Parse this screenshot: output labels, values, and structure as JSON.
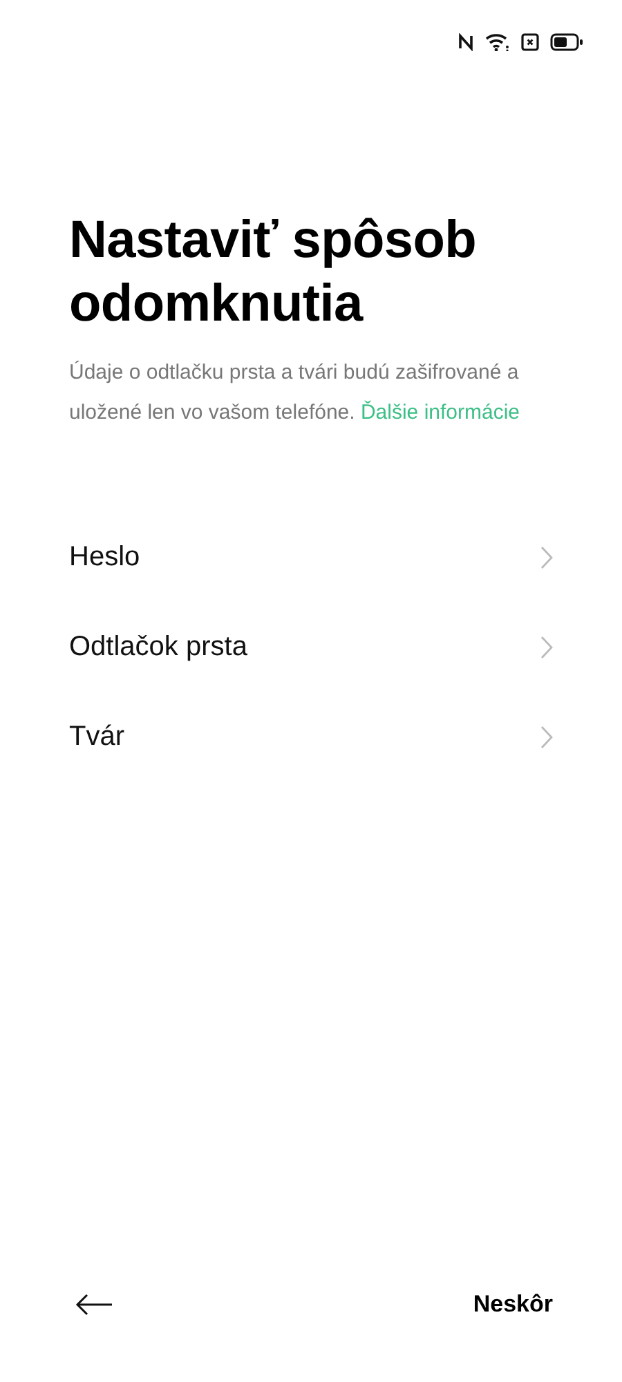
{
  "title": "Nastaviť spôsob odomknutia",
  "description": {
    "text": "Údaje o odtlačku prsta a tvári budú zašifrované a uložené len vo vašom telefóne.",
    "link": "Ďalšie informácie"
  },
  "options": [
    {
      "label": "Heslo"
    },
    {
      "label": "Odtlačok prsta"
    },
    {
      "label": "Tvár"
    }
  ],
  "footer": {
    "later_button": "Neskôr"
  }
}
